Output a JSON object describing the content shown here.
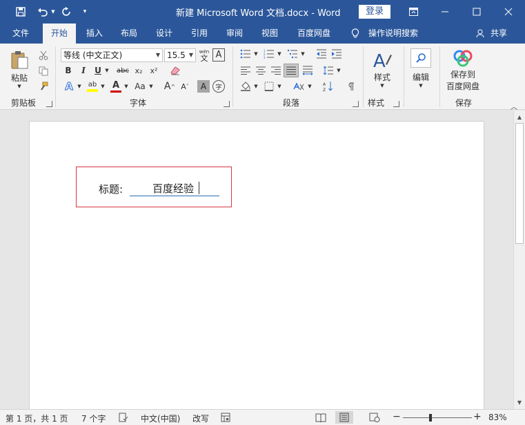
{
  "window": {
    "doc_title": "新建 Microsoft Word 文档.docx  -  Word",
    "login_label": "登录"
  },
  "tabs": [
    {
      "label": "文件"
    },
    {
      "label": "开始"
    },
    {
      "label": "插入"
    },
    {
      "label": "布局"
    },
    {
      "label": "设计"
    },
    {
      "label": "引用"
    },
    {
      "label": "审阅"
    },
    {
      "label": "视图"
    },
    {
      "label": "百度网盘"
    },
    {
      "label": "操作说明搜索"
    }
  ],
  "share_label": "共享",
  "ribbon": {
    "clipboard": {
      "paste_label": "粘贴",
      "group_label": "剪贴板"
    },
    "font": {
      "font_name": "等线 (中文正文)",
      "font_size": "15.5",
      "group_label": "字体",
      "phonetic": "wén",
      "phonetic_char": "文",
      "bold": "B",
      "italic": "I",
      "underline": "U",
      "strike": "abc",
      "subscript": "x₂",
      "superscript": "x²",
      "text_effect": "A",
      "highlight": "ab",
      "font_color": "A",
      "change_case": "Aa",
      "grow": "A",
      "shrink": "A",
      "border_char": "A",
      "enclose_char": "字"
    },
    "paragraph": {
      "group_label": "段落"
    },
    "styles": {
      "label": "样式",
      "group_label": "样式"
    },
    "editing": {
      "label": "编辑"
    },
    "save": {
      "label_line1": "保存到",
      "label_line2": "百度网盘",
      "group_label": "保存"
    }
  },
  "document": {
    "field_label": "标题:",
    "field_value": "百度经验"
  },
  "status": {
    "page": "第 1 页，共 1 页",
    "words": "7 个字",
    "language": "中文(中国)",
    "mode": "改写",
    "zoom": "83%"
  },
  "colors": {
    "brand": "#2b579a",
    "highlight": "#ffff00",
    "font_color": "#d00000",
    "field_border": "#d9363e"
  }
}
